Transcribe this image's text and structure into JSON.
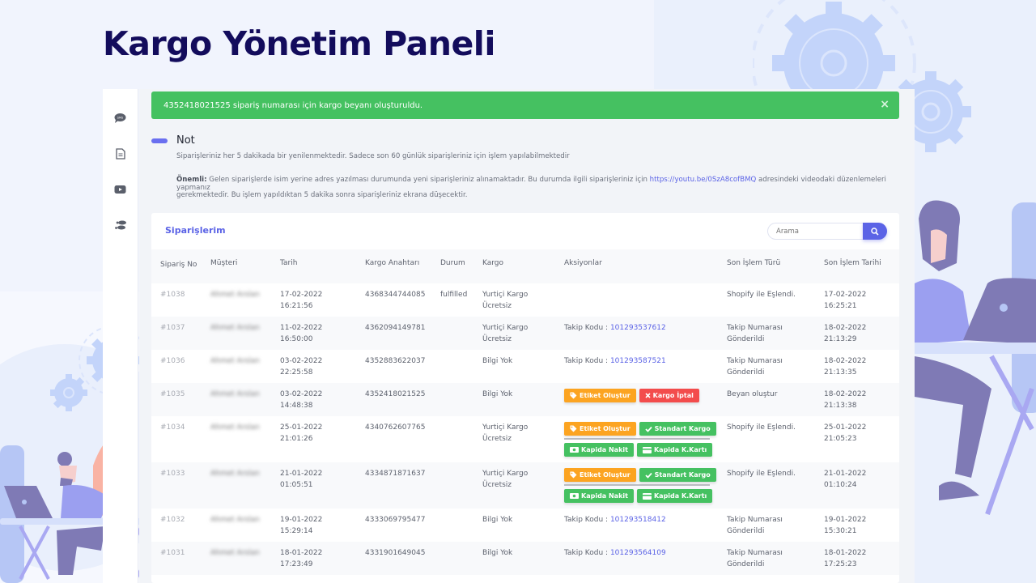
{
  "page": {
    "title": "Kargo Yönetim Paneli"
  },
  "sidebar": {
    "items": [
      {
        "icon": "sms-icon"
      },
      {
        "icon": "document-icon"
      },
      {
        "icon": "youtube-icon"
      },
      {
        "icon": "footsteps-icon"
      }
    ]
  },
  "alert": {
    "message": "4352418021525 sipariş numarası için kargo beyanı oluşturuldu.",
    "close_label": "×",
    "color": "#45c161"
  },
  "note": {
    "title": "Not",
    "line1": "Siparişleriniz her 5 dakikada bir yenilenmektedir. Sadece son 60 günlük siparişleriniz için işlem yapılabilmektedir",
    "important_label": "Önemli:",
    "line2_before": " Gelen siparişlerde isim yerine adres yazılması durumunda yeni siparişleriniz alınamaktadır. Bu durumda ilgili siparişleriniz için ",
    "link": "https://youtu.be/0SzA8cofBMQ",
    "line2_after": " adresindeki videodaki düzenlemeleri yapmanız",
    "line3": "gerekmektedir. Bu işlem yapıldıktan 5 dakika sonra siparişleriniz ekrana düşecektir."
  },
  "orders": {
    "title": "Siparişlerim",
    "search_placeholder": "Arama",
    "columns": {
      "no": "Sipariş No",
      "customer": "Müşteri",
      "date": "Tarih",
      "key": "Kargo Anahtarı",
      "status": "Durum",
      "cargo": "Kargo",
      "actions": "Aksiyonlar",
      "last_type": "Son İşlem Türü",
      "last_date": "Son İşlem Tarihi"
    },
    "tracking_label": "Takip Kodu : ",
    "buttons": {
      "label": "Etiket Oluştur",
      "cancel": "Kargo İptal",
      "standard": "Standart Kargo",
      "cash": "Kapida Nakit",
      "card": "Kapida K.Kartı"
    },
    "rows": [
      {
        "no": "#1038",
        "customer": "Ahmet Arslan",
        "date": "17-02-2022",
        "time": "16:21:56",
        "key": "4368344744085",
        "status": "fulfilled",
        "cargo1": "Yurtiçi Kargo",
        "cargo2": "Ücretsiz",
        "tracking": "",
        "last_type1": "Shopify ile Eşlendi.",
        "last_type2": "",
        "last_date": "17-02-2022",
        "last_time": "16:25:21"
      },
      {
        "no": "#1037",
        "customer": "Ahmet Arslan",
        "date": "11-02-2022",
        "time": "16:50:00",
        "key": "4362094149781",
        "status": "",
        "cargo1": "Yurtiçi Kargo",
        "cargo2": "Ücretsiz",
        "tracking": "101293537612",
        "last_type1": "Takip Numarası",
        "last_type2": "Gönderildi",
        "last_date": "18-02-2022",
        "last_time": "21:13:29"
      },
      {
        "no": "#1036",
        "customer": "Ahmet Arslan",
        "date": "03-02-2022",
        "time": "22:25:58",
        "key": "4352883622037",
        "status": "",
        "cargo1": "Bilgi Yok",
        "cargo2": "",
        "tracking": "101293587521",
        "last_type1": "Takip Numarası",
        "last_type2": "Gönderildi",
        "last_date": "18-02-2022",
        "last_time": "21:13:35"
      },
      {
        "no": "#1035",
        "customer": "Ahmet Arslan",
        "date": "03-02-2022",
        "time": "14:48:38",
        "key": "4352418021525",
        "status": "",
        "cargo1": "Bilgi Yok",
        "cargo2": "",
        "tracking": "",
        "last_type1": "Beyan oluştur",
        "last_type2": "",
        "last_date": "18-02-2022",
        "last_time": "21:13:38"
      },
      {
        "no": "#1034",
        "customer": "Ahmet Arslan",
        "date": "25-01-2022",
        "time": "21:01:26",
        "key": "4340762607765",
        "status": "",
        "cargo1": "Yurtiçi Kargo",
        "cargo2": "Ücretsiz",
        "tracking": "",
        "last_type1": "Shopify ile Eşlendi.",
        "last_type2": "",
        "last_date": "25-01-2022",
        "last_time": "21:05:23"
      },
      {
        "no": "#1033",
        "customer": "Ahmet Arslan",
        "date": "21-01-2022",
        "time": "01:05:51",
        "key": "4334871871637",
        "status": "",
        "cargo1": "Yurtiçi Kargo",
        "cargo2": "Ücretsiz",
        "tracking": "",
        "last_type1": "Shopify ile Eşlendi.",
        "last_type2": "",
        "last_date": "21-01-2022",
        "last_time": "01:10:24"
      },
      {
        "no": "#1032",
        "customer": "Ahmet Arslan",
        "date": "19-01-2022",
        "time": "15:29:14",
        "key": "4333069795477",
        "status": "",
        "cargo1": "Bilgi Yok",
        "cargo2": "",
        "tracking": "101293518412",
        "last_type1": "Takip Numarası",
        "last_type2": "Gönderildi",
        "last_date": "19-01-2022",
        "last_time": "15:30:21"
      },
      {
        "no": "#1031",
        "customer": "Ahmet Arslan",
        "date": "18-01-2022",
        "time": "17:23:49",
        "key": "4331901649045",
        "status": "",
        "cargo1": "Bilgi Yok",
        "cargo2": "",
        "tracking": "101293564109",
        "last_type1": "Takip Numarası",
        "last_type2": "Gönderildi",
        "last_date": "18-01-2022",
        "last_time": "17:25:23"
      }
    ]
  },
  "colors": {
    "accent": "#5b63e6",
    "title": "#130c5c",
    "success": "#45c161",
    "warning": "#fca421",
    "danger": "#f34c4c"
  }
}
